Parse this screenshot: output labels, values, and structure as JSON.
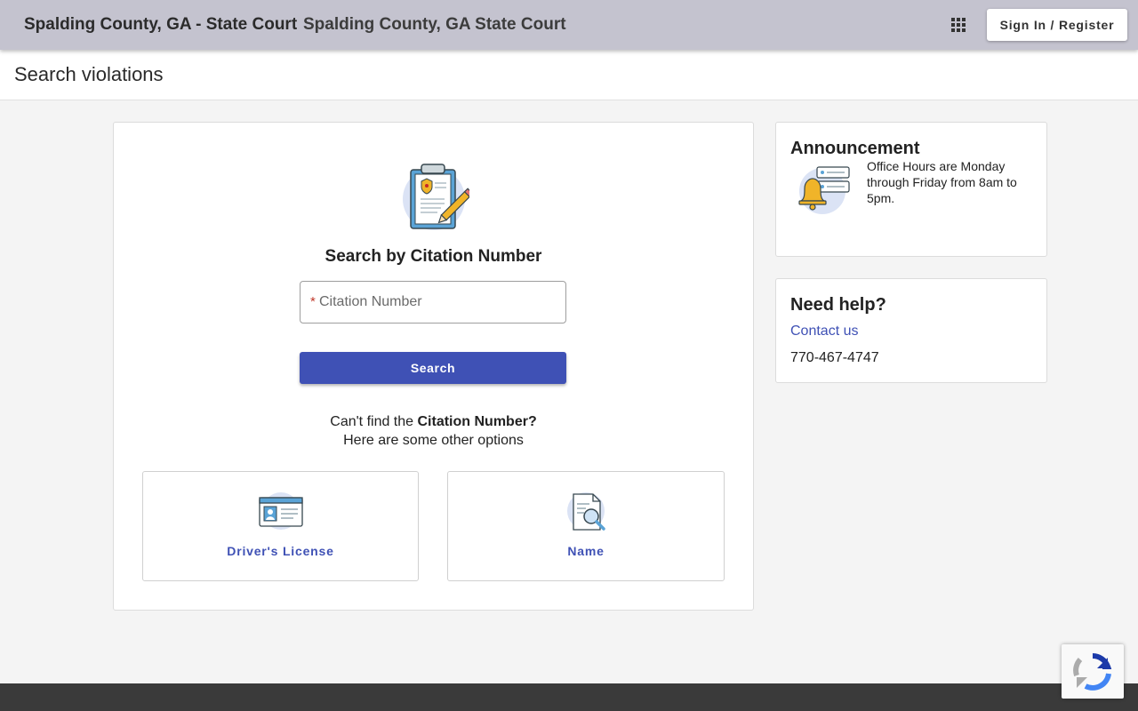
{
  "header": {
    "agency_name": "Spalding County, GA - State Court",
    "court_name": "Spalding County, GA State Court",
    "apps_icon": "apps-grid-icon",
    "signin_label": "Sign In / Register"
  },
  "page": {
    "title": "Search violations"
  },
  "search": {
    "icon": "clipboard-citation-icon",
    "title": "Search by Citation Number",
    "required_mark": "*",
    "citation_placeholder": "Citation Number",
    "citation_value": "",
    "button_label": "Search",
    "help_prefix": "Can't find the ",
    "help_bold": "Citation Number?",
    "help_line2": "Here are some other options"
  },
  "options": [
    {
      "label": "Driver's License",
      "icon": "id-card-icon"
    },
    {
      "label": "Name",
      "icon": "document-search-icon"
    }
  ],
  "announcement": {
    "title": "Announcement",
    "icon": "bell-notification-icon",
    "text": "Office Hours are Monday through Friday from 8am to 5pm."
  },
  "help": {
    "title": "Need help?",
    "contact_label": "Contact us",
    "phone": "770-467-4747"
  },
  "colors": {
    "topbar": "#c4c3cf",
    "primary": "#3f51b5",
    "footer": "#3a3a3a",
    "required": "#c0392b"
  },
  "recaptcha": {
    "icon": "recaptcha-icon"
  }
}
